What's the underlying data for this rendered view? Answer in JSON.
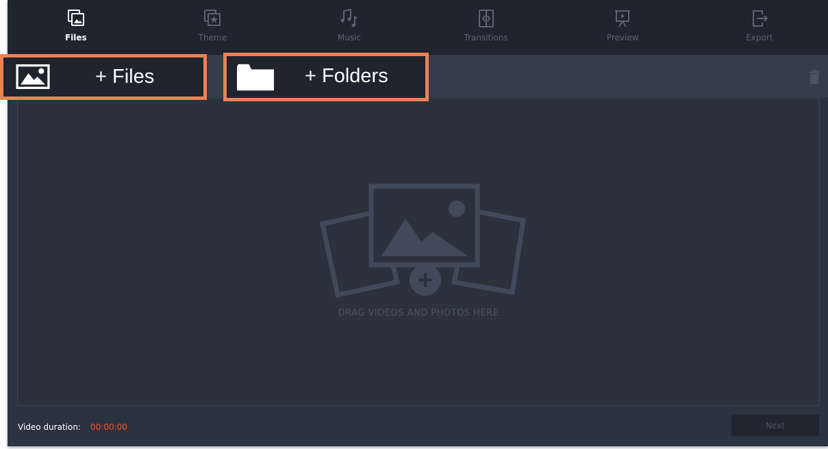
{
  "tabs": [
    {
      "label": "Files",
      "icon": "files-icon",
      "active": true
    },
    {
      "label": "Theme",
      "icon": "theme-icon",
      "active": false
    },
    {
      "label": "Music",
      "icon": "music-icon",
      "active": false
    },
    {
      "label": "Transitions",
      "icon": "transitions-icon",
      "active": false
    },
    {
      "label": "Preview",
      "icon": "preview-icon",
      "active": false
    },
    {
      "label": "Export",
      "icon": "export-icon",
      "active": false
    }
  ],
  "actions": {
    "add_files_label": "+ Files",
    "add_folders_label": "+ Folders",
    "trash_icon": "trash-icon"
  },
  "dropzone": {
    "text": "DRAG VIDEOS AND PHOTOS HERE",
    "icon": "add-media-icon"
  },
  "footer": {
    "duration_label": "Video duration:",
    "duration_value": "00:00:00",
    "next_label": "Next"
  },
  "colors": {
    "accent": "#ef8155",
    "duration": "#e8582e",
    "background": "#2b3240",
    "toolbar": "#1f242e"
  }
}
